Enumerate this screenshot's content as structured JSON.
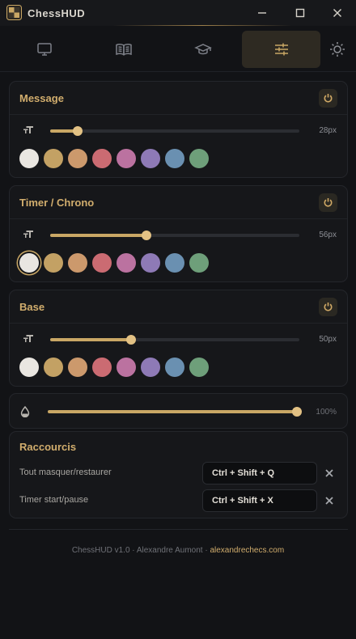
{
  "app": {
    "title": "ChessHUD"
  },
  "tabs": [
    {
      "icon": "monitor-icon",
      "active": false
    },
    {
      "icon": "book-icon",
      "active": false
    },
    {
      "icon": "graduation-cap-icon",
      "active": false
    },
    {
      "icon": "sliders-icon",
      "active": true
    }
  ],
  "theme_toggle": {
    "icon": "sun-icon"
  },
  "sections": [
    {
      "title": "Message",
      "size_label": "28px",
      "size_fraction": 0.11,
      "selected_color_index": -1
    },
    {
      "title": "Timer / Chrono",
      "size_label": "56px",
      "size_fraction": 0.385,
      "selected_color_index": 0
    },
    {
      "title": "Base",
      "size_label": "50px",
      "size_fraction": 0.325,
      "selected_color_index": -1
    }
  ],
  "palette": [
    "#e9e6e1",
    "#c3a164",
    "#cc996c",
    "#cb6b72",
    "#bb72a0",
    "#8e7ab6",
    "#6a90b1",
    "#6e9f7a"
  ],
  "opacity": {
    "label": "100%",
    "fraction": 1.0
  },
  "shortcuts": {
    "title": "Raccourcis",
    "rows": [
      {
        "label": "Tout masquer/restaurer",
        "keys": "Ctrl + Shift + Q"
      },
      {
        "label": "Timer start/pause",
        "keys": "Ctrl + Shift + X"
      }
    ]
  },
  "footer": {
    "text": "ChessHUD v1.0 · Alexandre Aumont · ",
    "link": "alexandrechecs.com"
  },
  "colors": {
    "accent": "#c9a765",
    "background": "#121316",
    "card": "#16171a"
  }
}
